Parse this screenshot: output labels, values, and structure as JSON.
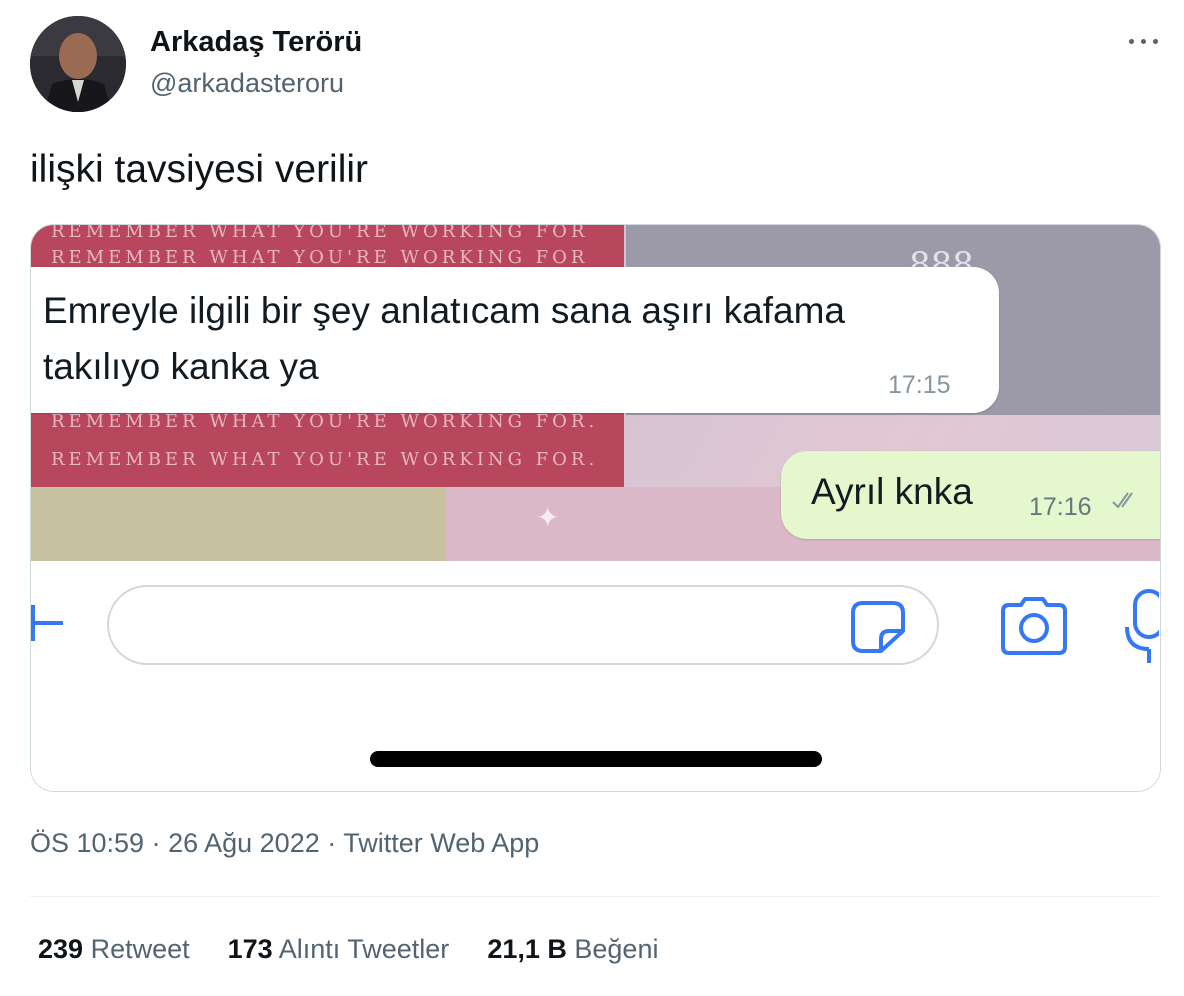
{
  "tweet": {
    "author": {
      "display_name": "Arkadaş Terörü",
      "handle": "@arkadasteroru"
    },
    "text": "ilişki tavsiyesi verilir",
    "meta": "ÖS 10:59 · 26 Ağu 2022 · Twitter Web App",
    "stats": [
      {
        "count": "239",
        "label": "Retweet"
      },
      {
        "count": "173",
        "label": "Alıntı Tweetler"
      },
      {
        "count": "21,1 B",
        "label": "Beğeni"
      }
    ]
  },
  "media": {
    "background_text": [
      "REMEMBER WHAT YOU'RE WORKING FOR",
      "REMEMBER WHAT YOU'RE WORKING FOR",
      "REMEMBER WHAT YOU'RE WORKING FOR.",
      "REMEMBER WHAT YOU'RE WORKING FOR."
    ],
    "background_glyph": "888",
    "incoming_message": {
      "text": "Emreyle ilgili bir şey anlatıcam sana aşırı kafama takılıyo kanka ya",
      "time": "17:15"
    },
    "outgoing_message": {
      "text": "Ayrıl knka",
      "time": "17:16",
      "status_icon": "double-check-icon"
    },
    "composer_icons": [
      "plus-icon",
      "sticker-icon",
      "camera-icon",
      "mic-icon"
    ]
  },
  "colors": {
    "accent_blue": "#3478f6",
    "outgoing_bubble": "#e4f7cd",
    "secondary_text": "#536471"
  }
}
